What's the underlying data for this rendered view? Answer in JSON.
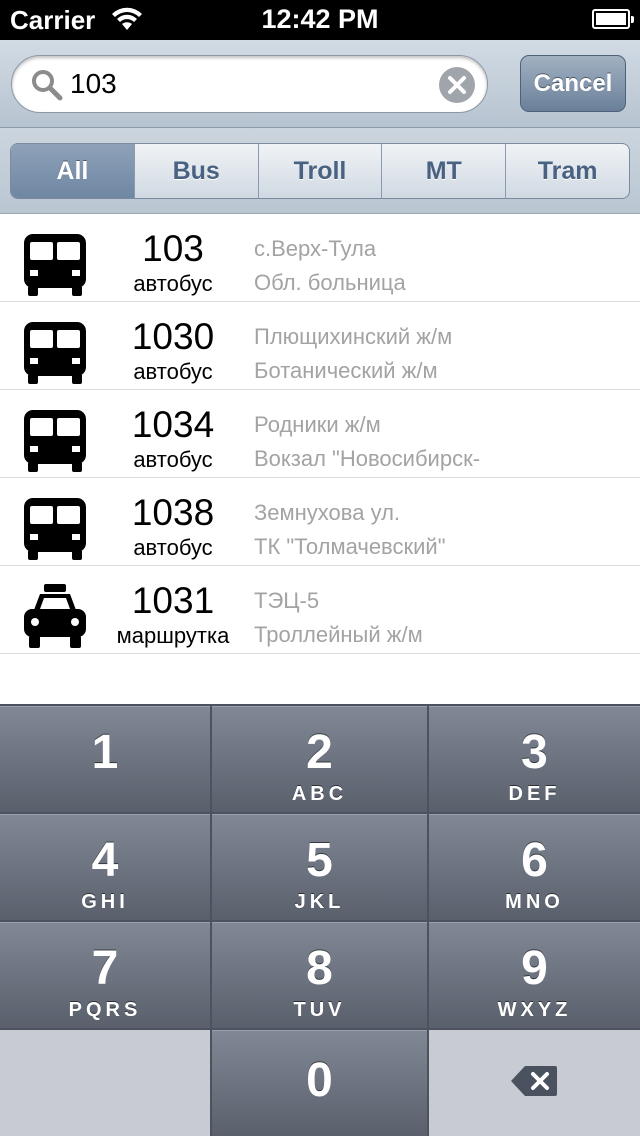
{
  "status_bar": {
    "carrier": "Carrier",
    "time": "12:42 PM"
  },
  "search": {
    "value": "103",
    "cancel_label": "Cancel"
  },
  "filters": [
    {
      "label": "All",
      "selected": true
    },
    {
      "label": "Bus",
      "selected": false
    },
    {
      "label": "Troll",
      "selected": false
    },
    {
      "label": "MT",
      "selected": false
    },
    {
      "label": "Tram",
      "selected": false
    }
  ],
  "results": [
    {
      "number": "103",
      "type": "автобус",
      "from": "с.Верх-Тула",
      "to": "Обл. больница",
      "icon": "bus-icon"
    },
    {
      "number": "1030",
      "type": "автобус",
      "from": "Плющихинский ж/м",
      "to": "Ботанический ж/м",
      "icon": "bus-icon"
    },
    {
      "number": "1034",
      "type": "автобус",
      "from": "Родники ж/м",
      "to": "Вокзал \"Новосибирск-",
      "icon": "bus-icon"
    },
    {
      "number": "1038",
      "type": "автобус",
      "from": "Земнухова ул.",
      "to": "ТК \"Толмачевский\"",
      "icon": "bus-icon"
    },
    {
      "number": "1031",
      "type": "маршрутка",
      "from": "ТЭЦ-5",
      "to": "Троллейный ж/м",
      "icon": "taxi-icon"
    }
  ],
  "keypad": [
    {
      "digit": "1",
      "letters": ""
    },
    {
      "digit": "2",
      "letters": "ABC"
    },
    {
      "digit": "3",
      "letters": "DEF"
    },
    {
      "digit": "4",
      "letters": "GHI"
    },
    {
      "digit": "5",
      "letters": "JKL"
    },
    {
      "digit": "6",
      "letters": "MNO"
    },
    {
      "digit": "7",
      "letters": "PQRS"
    },
    {
      "digit": "8",
      "letters": "TUV"
    },
    {
      "digit": "9",
      "letters": "WXYZ"
    },
    {
      "digit": "0",
      "letters": ""
    }
  ]
}
